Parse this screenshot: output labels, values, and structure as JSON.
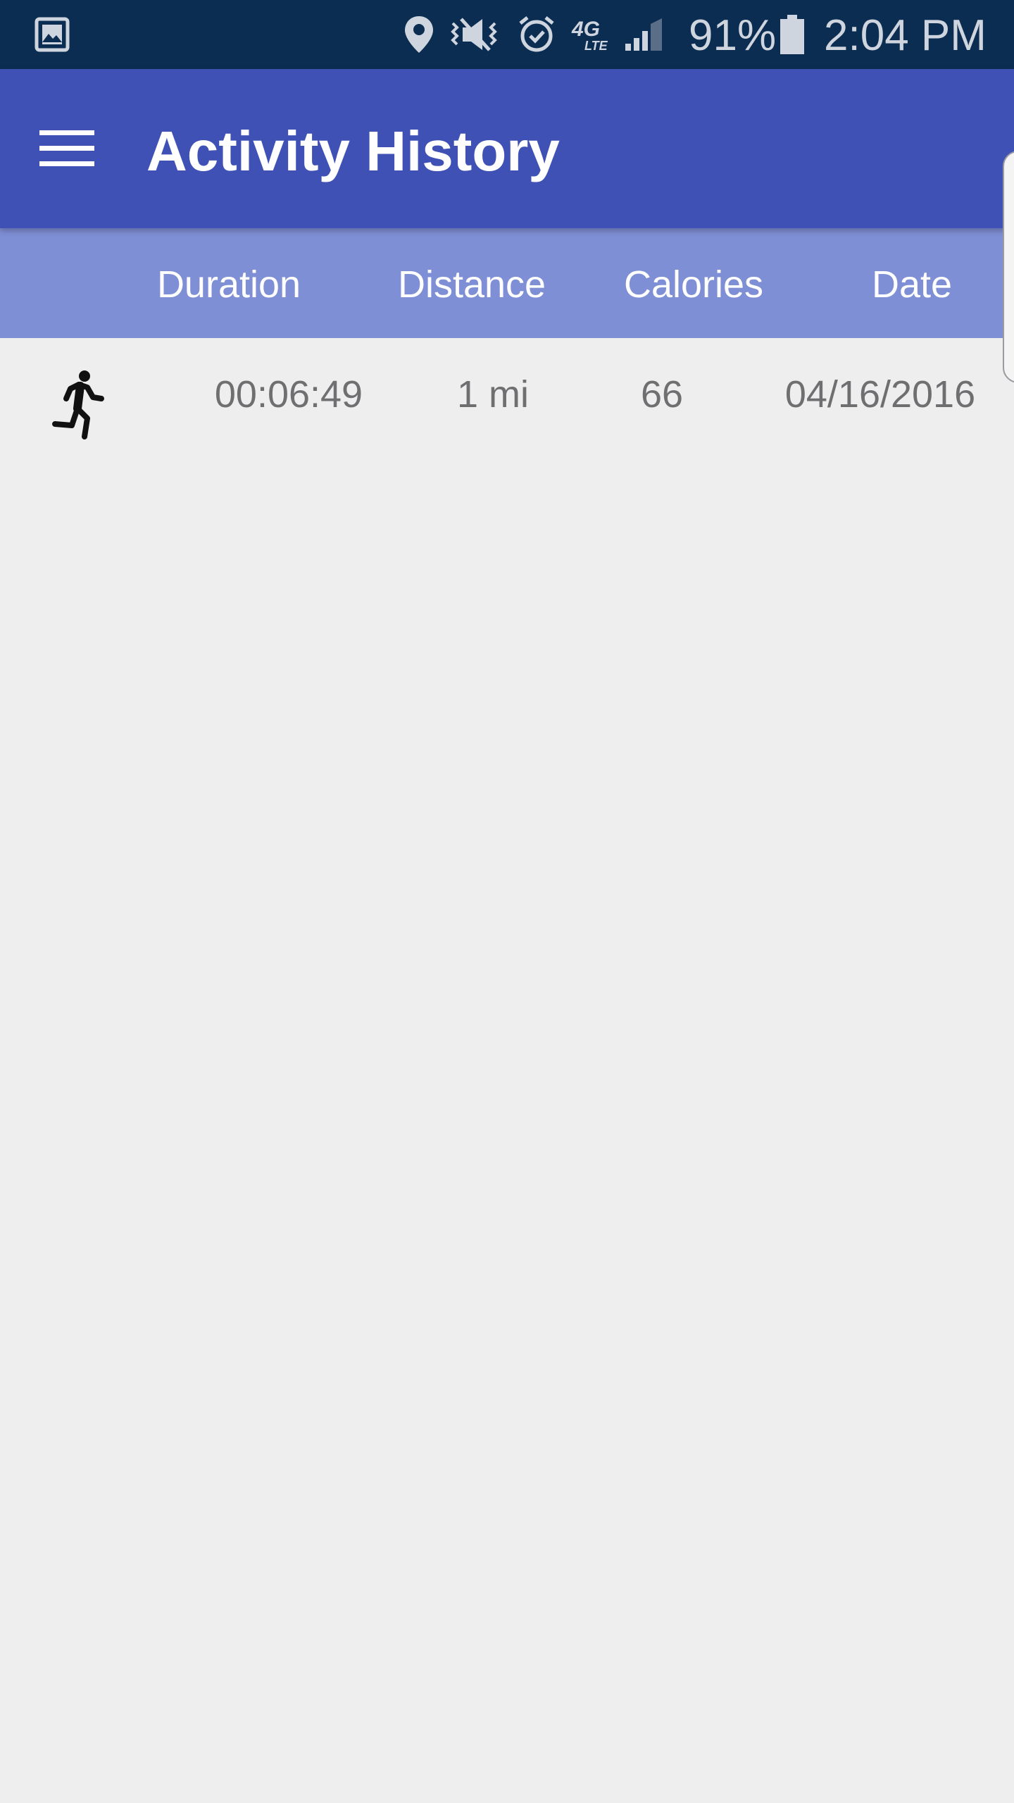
{
  "status_bar": {
    "battery": "91%",
    "time": "2:04 PM",
    "icons": [
      "gallery-icon",
      "location-icon",
      "vibrate-mute-icon",
      "alarm-icon",
      "4g-lte-icon",
      "signal-icon",
      "battery-icon"
    ]
  },
  "app_bar": {
    "title": "Activity History",
    "menu_icon": "hamburger-menu-icon",
    "background": "#3f51b5"
  },
  "table": {
    "header_background": "#7f8fd6",
    "columns": [
      "Duration",
      "Distance",
      "Calories",
      "Date"
    ],
    "rows": [
      {
        "activity_icon": "running-icon",
        "duration": "00:06:49",
        "distance": "1 mi",
        "calories": "66",
        "date": "04/16/2016"
      }
    ]
  }
}
